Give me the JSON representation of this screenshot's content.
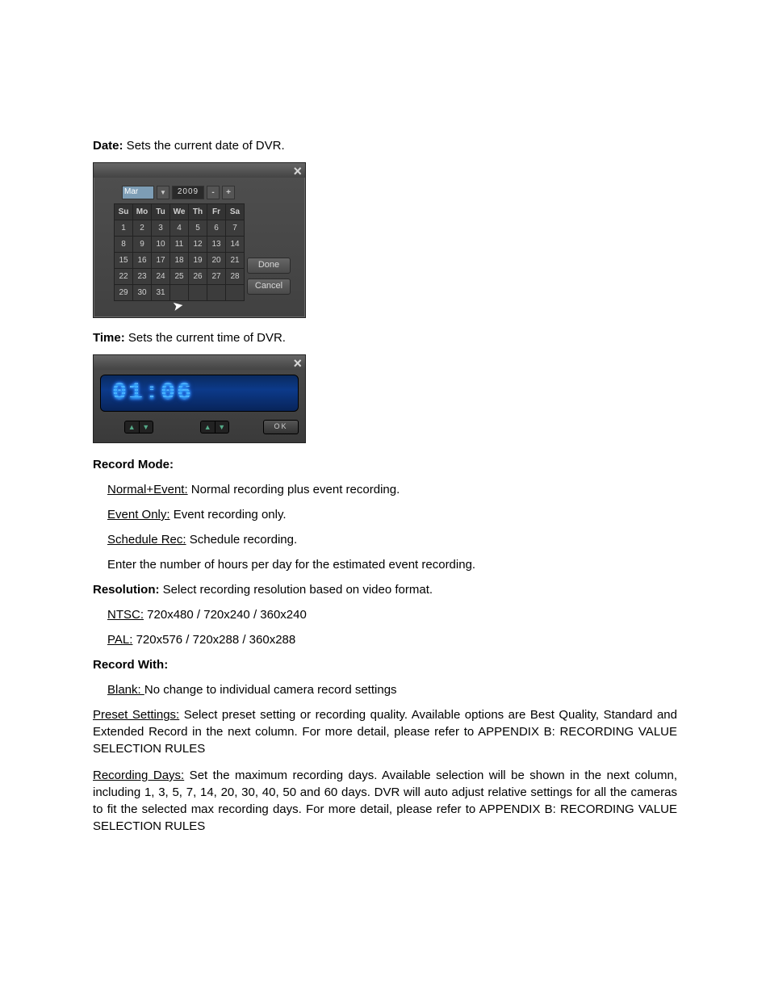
{
  "text": {
    "date_label": "Date:",
    "date_desc": " Sets the current date of DVR.",
    "time_label": "Time:",
    "time_desc": " Sets the current time of DVR.",
    "record_mode_label": "Record Mode:",
    "normal_event_label": "Normal+Event:",
    "normal_event_desc": " Normal recording plus event recording.",
    "event_only_label": "Event Only:",
    "event_only_desc": " Event recording only.",
    "schedule_rec_label": "Schedule Rec:",
    "schedule_rec_desc": " Schedule recording.",
    "hours_desc": "Enter the number of hours per day for the estimated event recording.",
    "resolution_label": "Resolution:",
    "resolution_desc": " Select recording resolution based on video format.",
    "ntsc_label": "NTSC:",
    "ntsc_desc": " 720x480 / 720x240 / 360x240",
    "pal_label": "PAL:",
    "pal_desc": " 720x576 / 720x288 / 360x288",
    "record_with_label": "Record With:",
    "blank_label": "Blank: ",
    "blank_desc": "No change to individual camera record settings",
    "preset_label": "Preset Settings:",
    "preset_desc": " Select preset setting or recording quality. Available options are Best Quality, Standard and Extended Record in the next column. For more detail, please refer to APPENDIX B:  RECORDING VALUE SELECTION RULES",
    "recdays_label": "Recording Days:",
    "recdays_desc": " Set the maximum recording days. Available selection will be shown in the next column, including 1, 3, 5, 7, 14, 20, 30, 40, 50 and 60 days. DVR will auto adjust relative settings for all the cameras to fit the selected max recording days. For more detail, please refer to APPENDIX B: RECORDING VALUE SELECTION RULES"
  },
  "datepicker": {
    "close_glyph": "×",
    "month": "Mar",
    "year": "2009",
    "minus": "-",
    "plus": "+",
    "dropdown_glyph": "▼",
    "dow": [
      "Su",
      "Mo",
      "Tu",
      "We",
      "Th",
      "Fr",
      "Sa"
    ],
    "rows": [
      [
        "1",
        "2",
        "3",
        "4",
        "5",
        "6",
        "7"
      ],
      [
        "8",
        "9",
        "10",
        "11",
        "12",
        "13",
        "14"
      ],
      [
        "15",
        "16",
        "17",
        "18",
        "19",
        "20",
        "21"
      ],
      [
        "22",
        "23",
        "24",
        "25",
        "26",
        "27",
        "28"
      ],
      [
        "29",
        "30",
        "31",
        "",
        "",
        "",
        ""
      ]
    ],
    "done_label": "Done",
    "cancel_label": "Cancel",
    "cursor_glyph": "↖"
  },
  "timepicker": {
    "close_glyph": "×",
    "display": "01:06",
    "up_glyph": "▲",
    "down_glyph": "▼",
    "ok_label": "OK"
  }
}
